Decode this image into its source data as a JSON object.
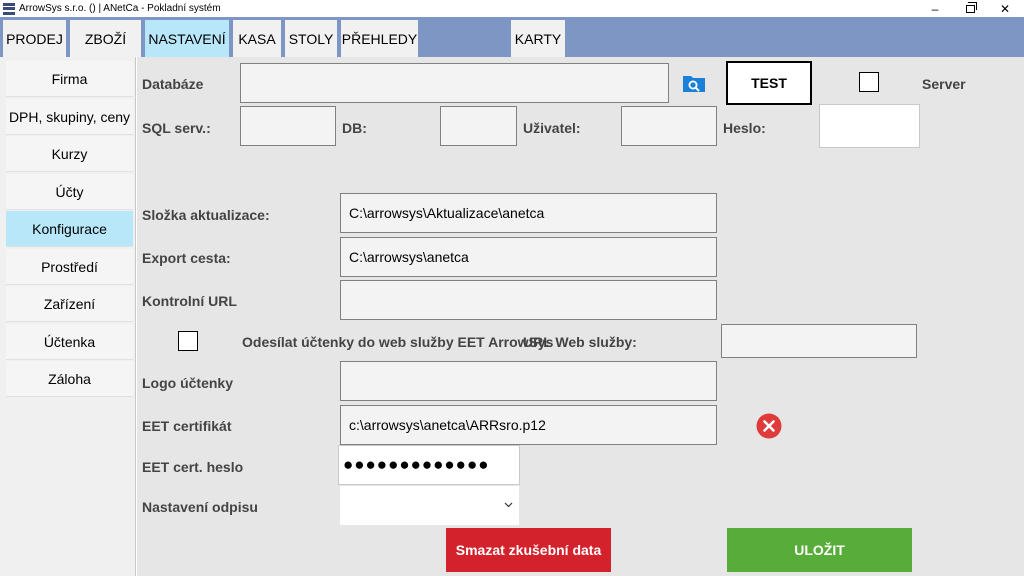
{
  "window": {
    "title": "ArrowSys s.r.o. () | ANetCa - Pokladní systém"
  },
  "menu": {
    "tabs": [
      {
        "label": "PRODEJ"
      },
      {
        "label": "ZBOŽÍ"
      },
      {
        "label": "NASTAVENÍ"
      },
      {
        "label": "KASA"
      },
      {
        "label": "STOLY"
      },
      {
        "label": "PŘEHLEDY"
      },
      {
        "label": "KARTY"
      }
    ],
    "active": "NASTAVENÍ"
  },
  "sidebar": {
    "items": [
      {
        "label": "Firma"
      },
      {
        "label": "DPH, skupiny, ceny"
      },
      {
        "label": "Kurzy"
      },
      {
        "label": "Účty"
      },
      {
        "label": "Konfigurace"
      },
      {
        "label": "Prostředí"
      },
      {
        "label": "Zařízení"
      },
      {
        "label": "Účtenka"
      },
      {
        "label": "Záloha"
      }
    ],
    "active": "Konfigurace"
  },
  "form": {
    "database": {
      "label": "Databáze",
      "value": ""
    },
    "test_button": "TEST",
    "server": {
      "label": "Server",
      "checked": false
    },
    "sql_server": {
      "label": "SQL serv.:",
      "value": ""
    },
    "db": {
      "label": "DB:",
      "value": ""
    },
    "user": {
      "label": "Uživatel:",
      "value": ""
    },
    "password": {
      "label": "Heslo:",
      "value": ""
    },
    "update_folder": {
      "label": "Složka aktualizace:",
      "value": "C:\\arrowsys\\Aktualizace\\anetca"
    },
    "export_path": {
      "label": "Export cesta:",
      "value": "C:\\arrowsys\\anetca"
    },
    "control_url": {
      "label": "Kontrolní URL",
      "value": ""
    },
    "eet_send": {
      "label": "Odesílat účtenky do web služby EET ArrowSys",
      "checked": false
    },
    "web_service_url": {
      "label": "URL Web služby:",
      "value": ""
    },
    "receipt_logo": {
      "label": "Logo účtenky",
      "value": ""
    },
    "eet_certificate": {
      "label": "EET certifikát",
      "value": "c:\\arrowsys\\anetca\\ARRsro.p12"
    },
    "eet_cert_password": {
      "label": "EET cert. heslo",
      "value": "●●●●●●●●●●●●●"
    },
    "write_off_setting": {
      "label": "Nastavení odpisu",
      "value": ""
    }
  },
  "buttons": {
    "delete_test_data": "Smazat zkušební data",
    "save": "ULOŽIT"
  },
  "colors": {
    "menubar": "#7e96c4",
    "active_tab": "#b7e7f9",
    "delete_button": "#d3222b",
    "save_button": "#58ad3a",
    "folder_icon": "#1b80d6",
    "clear_icon": "#e03b3b"
  },
  "icons": {
    "folder": "folder-search-icon",
    "clear": "clear-x-icon"
  }
}
